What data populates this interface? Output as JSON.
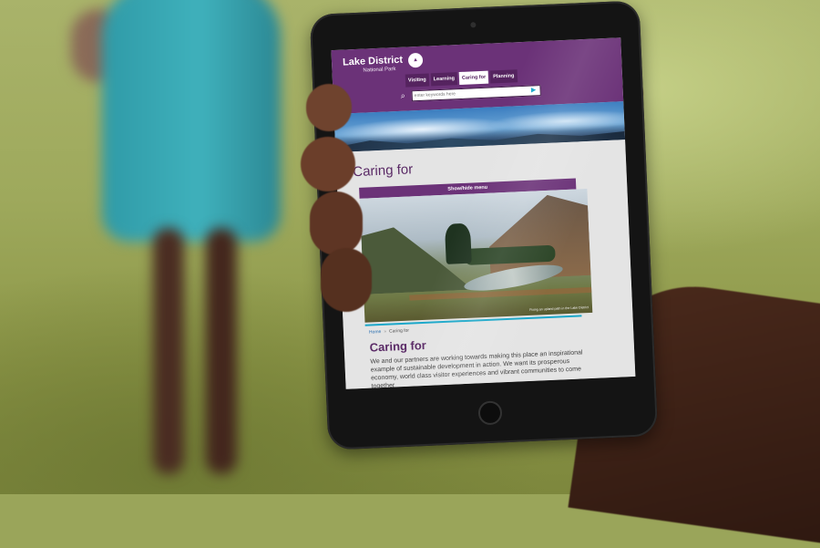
{
  "header": {
    "logo_title": "Lake District",
    "logo_subtitle": "National Park",
    "nav": [
      {
        "label": "Visiting",
        "active": false
      },
      {
        "label": "Learning",
        "active": false
      },
      {
        "label": "Caring for",
        "active": true
      },
      {
        "label": "Planning",
        "active": false
      }
    ],
    "search": {
      "placeholder": "enter keywords here"
    }
  },
  "colors": {
    "brand_purple": "#6b3278",
    "accent_cyan": "#1aa7c9"
  },
  "icons": {
    "search": "search-icon",
    "go": "arrow-right-icon"
  },
  "page": {
    "section_heading": "Caring for",
    "showhide_label": "Show/hide menu",
    "photo_caption": "Fixing an upland path in the Lake District",
    "breadcrumb": {
      "home": "Home",
      "current": "Caring for"
    },
    "title": "Caring for",
    "intro": "We and our partners are working towards making this place an inspirational example of sustainable development in action. We want its prosperous economy, world class visitor experiences and vibrant communities to come together"
  }
}
